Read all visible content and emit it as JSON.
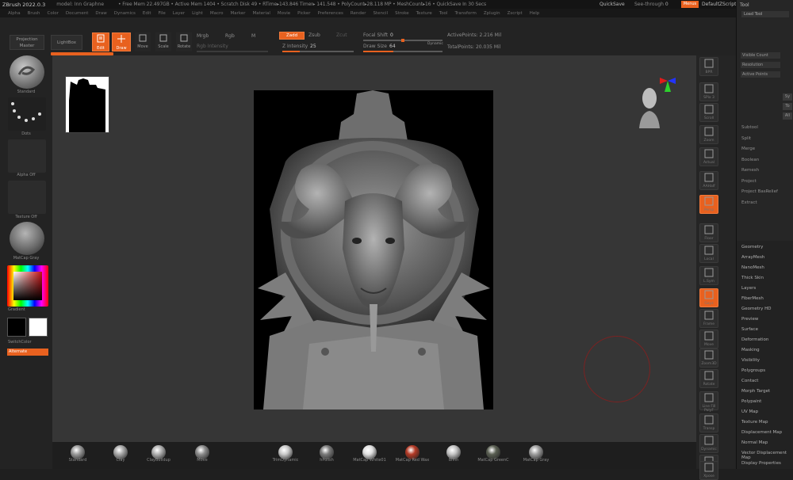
{
  "title_bar": {
    "app": "ZBrush 2022.0.3",
    "project": "model: Inn Graphne",
    "info": "• Free Mem 22.497GB • Active Mem 1404 • Scratch Disk 49 • RTime▸143.846 Timer▸ 141.548 • PolyCount▸28.118 MP • MeshCount▸16 • QuickSave In 30 Secs",
    "quicksave": "QuickSave",
    "see_through_label": "See-through",
    "see_through_value": "0",
    "menus_button": "Menus",
    "default_script": "DefaultZScript"
  },
  "menu_bar": [
    "Alpha",
    "Brush",
    "Color",
    "Document",
    "Draw",
    "Dynamics",
    "Edit",
    "File",
    "Layer",
    "Light",
    "Macro",
    "Marker",
    "Material",
    "Movie",
    "Picker",
    "Preferences",
    "Render",
    "Stencil",
    "Stroke",
    "Texture",
    "Tool",
    "Transform",
    "Zplugin",
    "Zscript",
    "Help"
  ],
  "toolbar": {
    "projection_master": "Projection Master",
    "lightbox": "LightBox",
    "edit": "Edit",
    "draw": "Draw",
    "move": "Move",
    "scale": "Scale",
    "rotate": "Rotate",
    "mrgb": "Mrgb",
    "rgb": "Rgb",
    "m": "M",
    "rgb_intensity": "Rgb Intensity",
    "zadd": "Zadd",
    "zsub": "Zsub",
    "zcut": "Zcut",
    "z_intensity_label": "Z Intensity",
    "z_intensity_value": "25",
    "focal_shift_label": "Focal Shift",
    "focal_shift_value": "0",
    "draw_size_label": "Draw Size",
    "draw_size_value": "64",
    "dynamic": "Dynamic",
    "active_points": "ActivePoints: 2.216 Mil",
    "total_points": "TotalPoints: 20.035 Mil"
  },
  "left_tray": {
    "brush": "Standard",
    "stroke": "Dots",
    "alpha": "Alpha Off",
    "texture": "Texture Off",
    "material": "MatCap Gray",
    "gradient": "Gradient",
    "switch_color": "SwitchColor",
    "alternate": "Alternate"
  },
  "right_shelf": {
    "buttons": [
      "BPR",
      "SPix 3",
      "Scroll",
      "Zoom",
      "Actual",
      "AAHalf",
      "Persp",
      "Floor",
      "Local",
      "L.Sym",
      "Gxyz",
      "Frame",
      "Move",
      "Zoom3D",
      "Rotate",
      "Line Fill PolyF",
      "Transp",
      "Dynamic",
      "Solo",
      "Xpose"
    ]
  },
  "right_palette": {
    "header": "Tool",
    "subheader": "Load Tool",
    "subtool_rows": [
      "Visible Count",
      "Resolution",
      "Active Points"
    ],
    "subtool_side": [
      "Sy",
      "To",
      "All"
    ],
    "list_a": [
      "Subtool",
      "Split",
      "Merge",
      "Boolean",
      "Remesh",
      "Project",
      "Project BasRelief",
      "Extract"
    ],
    "list_b": [
      "Geometry",
      "ArrayMesh",
      "NanoMesh",
      "Thick Skin",
      "Layers",
      "FiberMesh",
      "Geometry HD",
      "Preview",
      "Surface",
      "Deformation",
      "Masking",
      "Visibility",
      "Polygroups",
      "Contact",
      "Morph Target",
      "Polypaint",
      "UV Map",
      "Texture Map",
      "Displacement Map",
      "Normal Map",
      "Vector Displacement Map",
      "Display Properties"
    ]
  },
  "bottom_tray": {
    "materials": [
      "Standard",
      "Clay",
      "ClayBuildup",
      "Move",
      "TrimDynamic",
      "hPolish",
      "MatCap White01",
      "MatCap Red Wax",
      "Blinn",
      "MatCap GreenC",
      "MatCap Gray"
    ]
  },
  "colors": {
    "accent": "#e8611f",
    "background": "#363636",
    "panel": "#232323"
  }
}
